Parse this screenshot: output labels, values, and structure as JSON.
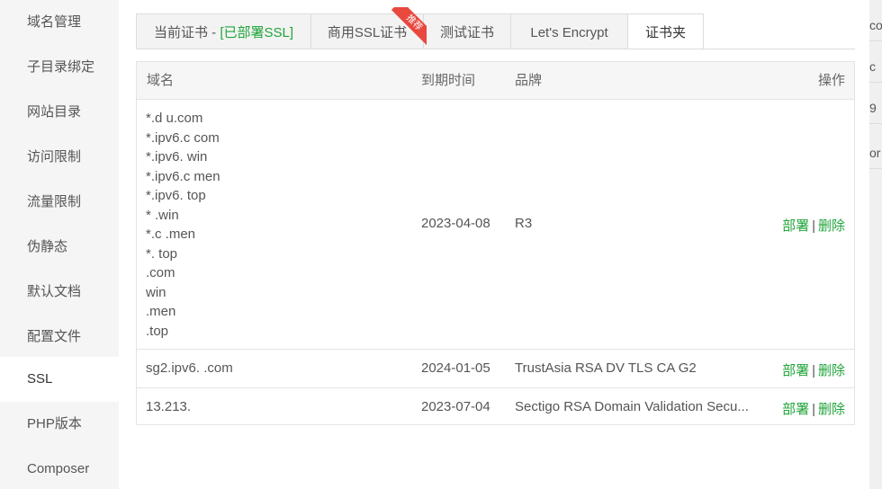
{
  "sidebar": {
    "items": [
      {
        "label": "域名管理"
      },
      {
        "label": "子目录绑定"
      },
      {
        "label": "网站目录"
      },
      {
        "label": "访问限制"
      },
      {
        "label": "流量限制"
      },
      {
        "label": "伪静态"
      },
      {
        "label": "默认文档"
      },
      {
        "label": "配置文件"
      },
      {
        "label": "SSL",
        "active": true
      },
      {
        "label": "PHP版本"
      },
      {
        "label": "Composer"
      }
    ]
  },
  "tabs": {
    "current_label": "当前证书 - ",
    "current_status": "[已部署SSL]",
    "commercial": "商用SSL证书",
    "recommend_badge": "推荐",
    "test": "测试证书",
    "letsencrypt": "Let's Encrypt",
    "folder": "证书夹"
  },
  "table": {
    "headers": {
      "domain": "域名",
      "expiry": "到期时间",
      "brand": "品牌",
      "action": "操作"
    },
    "rows": [
      {
        "domains": [
          "*.d    u.com",
          "*.ipv6.c       com",
          "*.ipv6.        win",
          "*.ipv6.c       men",
          "*.ipv6.       top",
          "*        .win",
          "*.c      .men",
          "*.       top",
          "         .com",
          "         win",
          "        .men",
          "        .top"
        ],
        "expiry": "2023-04-08",
        "brand": "R3",
        "deploy": "部署",
        "delete": "删除"
      },
      {
        "domains": [
          "sg2.ipv6.          .com"
        ],
        "expiry": "2024-01-05",
        "brand": "TrustAsia RSA DV TLS CA G2",
        "deploy": "部署",
        "delete": "删除"
      },
      {
        "domains": [
          "13.213."
        ],
        "expiry": "2023-07-04",
        "brand": "Sectigo RSA Domain Validation Secu...",
        "deploy": "部署",
        "delete": "删除"
      }
    ],
    "separator": "|"
  },
  "edge_fragments": [
    "co",
    "c",
    "9",
    "or"
  ],
  "colors": {
    "accent_green": "#20a53a",
    "ribbon_red": "#e9483f",
    "sidebar_bg": "#f5f5f5"
  }
}
